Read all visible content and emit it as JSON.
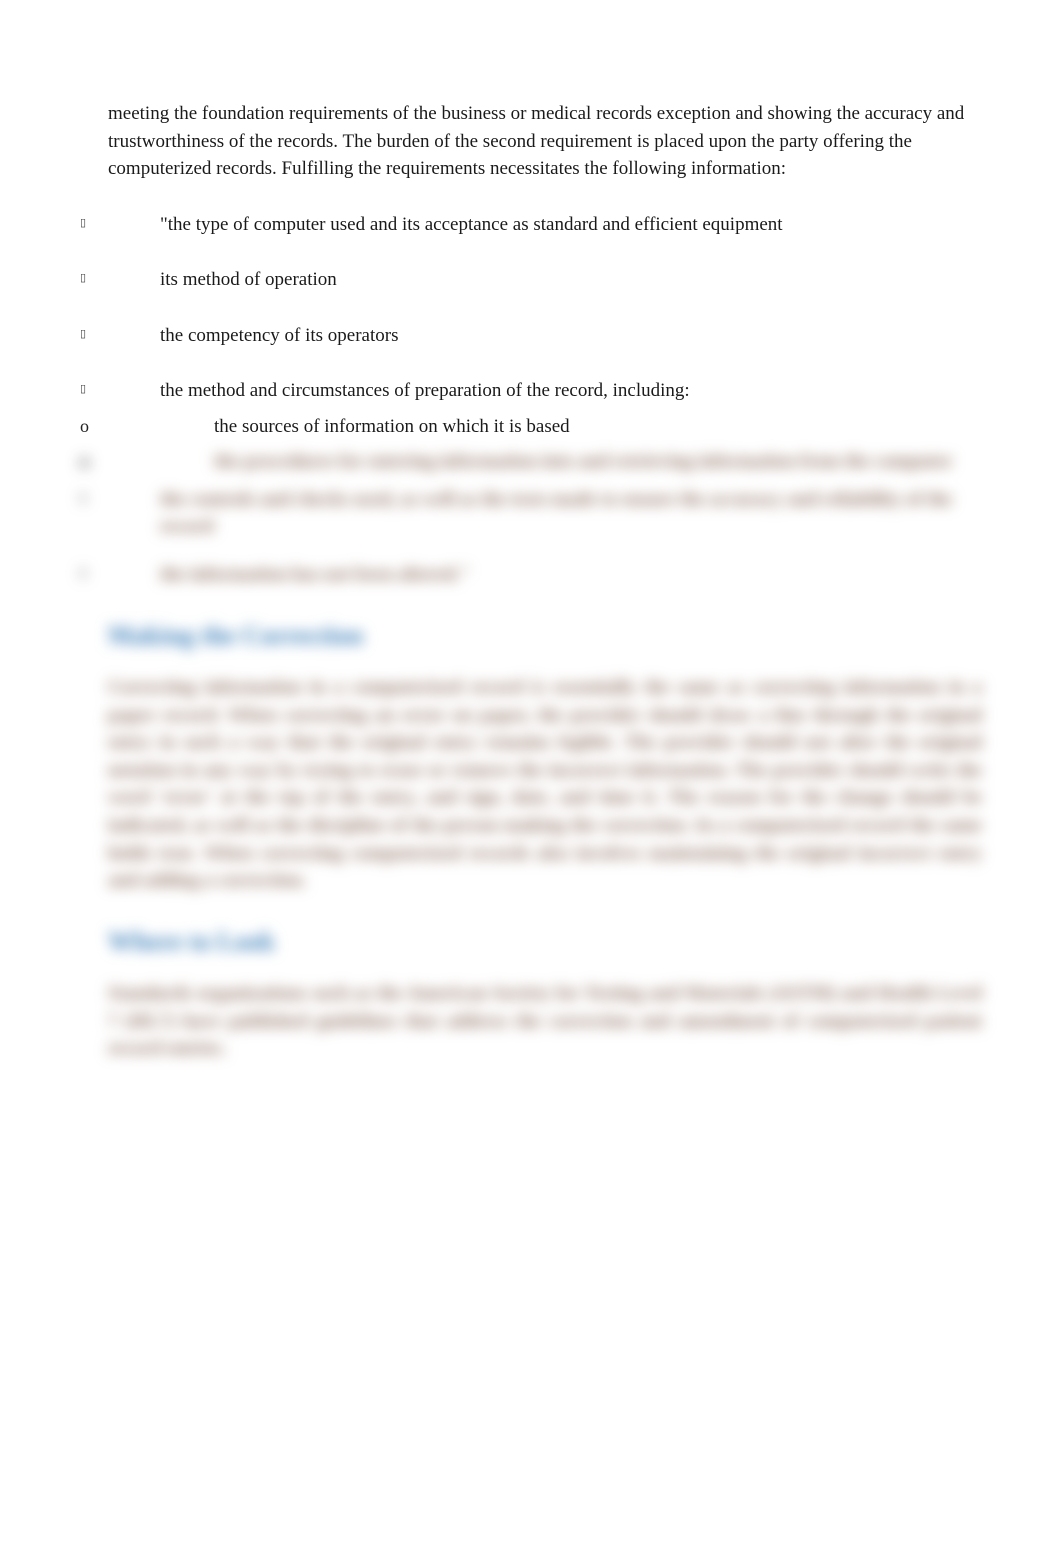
{
  "intro": "meeting the foundation requirements of the business or medical records exception and showing the accuracy and trustworthiness of the records. The burden of the second requirement is placed upon the party offering the computerized records. Fulfilling the requirements necessitates the following information:",
  "bullets": [
    "\"the type of computer used and its acceptance as standard and efficient equipment",
    "its method of operation",
    "the competency of its operators",
    "the method and circumstances of preparation of the record, including:"
  ],
  "sub_bullets": [
    "the sources of information on which it is based"
  ],
  "obscured": {
    "sub_items": [
      "the procedures for entering information into and retrieving information from the computer",
      "the controls and checks used, as well as the tests made to ensure the accuracy and reliability of the record"
    ],
    "last_bullet": "the information has not been altered.\"",
    "heading1": "Making the Correction",
    "para1": "Correcting information in a computerized record is essentially the same as correcting information in a paper record. When correcting an error on paper, the provider should draw a line through the original entry in such a way that the original entry remains legible. The provider should not alter the original notation in any way by trying to erase or remove the incorrect information. The provider should write the word 'error' at the top of the entry, and sign, date, and time it. The reason for the change should be indicated, as well as the discipline of the person making the correction. In a computerized record the same holds true. When correcting computerized records also involves maintaining the original incorrect entry and adding a correction.",
    "heading2": "Where to Look",
    "para2": "Standards organizations such as the American Society for Testing and Materials (ASTM) and Health Level 7 (HL7) have published guidelines that address the correction and amendment of computerized patient record entries."
  }
}
